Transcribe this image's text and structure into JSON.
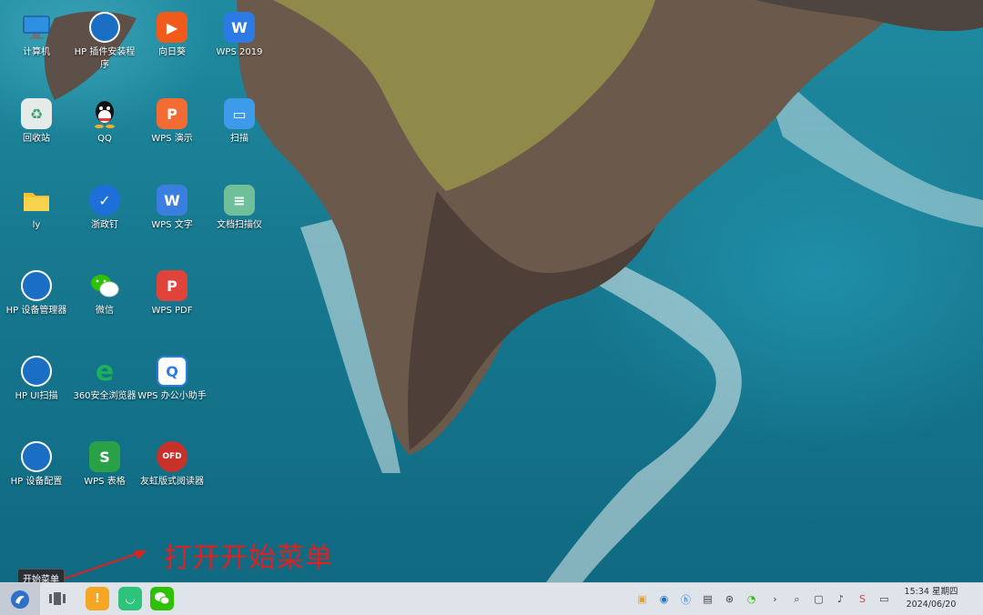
{
  "desktop_icons": [
    {
      "label": "计算机",
      "icon": "computer-icon",
      "text": "",
      "color": "#2f8fe0"
    },
    {
      "label": "HP 插件安装程序",
      "icon": "hp-icon",
      "text": "hp",
      "color": "#1a6fc4"
    },
    {
      "label": "向日葵",
      "icon": "sunflower-icon",
      "text": "▶",
      "color": "#f05a1a"
    },
    {
      "label": "WPS 2019",
      "icon": "wps-icon",
      "text": "W",
      "color": "#2c7be5"
    },
    {
      "label": "回收站",
      "icon": "recycle-bin-icon",
      "text": "♻",
      "color": "#c9d3cf"
    },
    {
      "label": "QQ",
      "icon": "qq-icon",
      "text": "",
      "color": "#111111"
    },
    {
      "label": "WPS 演示",
      "icon": "wps-presentation-icon",
      "text": "P",
      "color": "#f26b33"
    },
    {
      "label": "扫描",
      "icon": "scan-icon",
      "text": "▭",
      "color": "#3d9be9"
    },
    {
      "label": "ly",
      "icon": "folder-icon",
      "text": "",
      "color": "#f6c12e"
    },
    {
      "label": "浙政钉",
      "icon": "zhezhengding-icon",
      "text": "✓",
      "color": "#1e6fd9"
    },
    {
      "label": "WPS 文字",
      "icon": "wps-writer-icon",
      "text": "W",
      "color": "#3a7fe0"
    },
    {
      "label": "文档扫描仪",
      "icon": "document-scanner-icon",
      "text": "≡",
      "color": "#6fbf9a"
    },
    {
      "label": "HP 设备管理器",
      "icon": "hp-icon",
      "text": "hp",
      "color": "#1a6fc4"
    },
    {
      "label": "微信",
      "icon": "wechat-icon",
      "text": "",
      "color": "#2dc100"
    },
    {
      "label": "WPS PDF",
      "icon": "wps-pdf-icon",
      "text": "P",
      "color": "#e0433a"
    },
    {
      "label": "HP UI扫描",
      "icon": "hp-icon",
      "text": "hp",
      "color": "#1a6fc4"
    },
    {
      "label": "360安全浏览器",
      "icon": "browser-360-icon",
      "text": "e",
      "color": "#1bb05a"
    },
    {
      "label": "WPS 办公小助手",
      "icon": "wps-assistant-icon",
      "text": "Q",
      "color": "#ffffff"
    },
    {
      "label": "HP 设备配置",
      "icon": "hp-icon",
      "text": "hp",
      "color": "#1a6fc4"
    },
    {
      "label": "WPS 表格",
      "icon": "wps-spreadsheet-icon",
      "text": "S",
      "color": "#2aa146"
    },
    {
      "label": "友虹版式阅读器",
      "icon": "ofd-reader-icon",
      "text": "OFD",
      "color": "#c8302a"
    }
  ],
  "annotation": {
    "text": "打开开始菜单",
    "color": "#e02020"
  },
  "tooltip": {
    "text": "开始菜单"
  },
  "taskbar": {
    "start_icon": "start-menu-icon",
    "pinned": [
      {
        "icon": "multitask-view-icon",
        "color": "#5a6068"
      },
      {
        "icon": "file-manager-icon",
        "color": "#f5a623"
      },
      {
        "icon": "app-store-icon",
        "color": "#2dc37a"
      },
      {
        "icon": "wechat-icon",
        "color": "#2dc100"
      }
    ],
    "tray": [
      "folder-icon",
      "browser-icon",
      "hp-icon",
      "document-icon",
      "network-icon",
      "wechat-icon",
      "expand-icon",
      "search-icon",
      "screen-icon",
      "volume-icon",
      "sogou-icon",
      "notification-icon"
    ],
    "time": "15:34 星期四",
    "date": "2024/06/20"
  }
}
